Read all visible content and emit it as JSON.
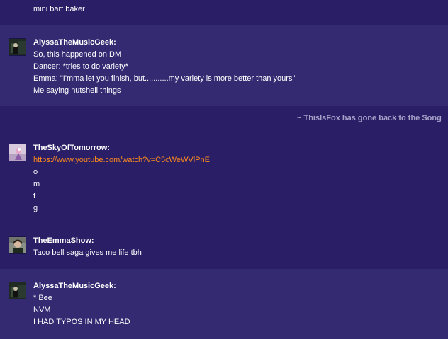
{
  "messages": [
    {
      "lines": [
        "mini bart baker"
      ]
    },
    {
      "user": "AlyssaTheMusicGeek:",
      "avatar": "avatar-alyssa",
      "lines": [
        "So, this happened on DM",
        "Dancer: *tries to do variety*",
        "Emma: \"I'mma let you finish, but...........my variety is more better than yours\"",
        "Me saying nutshell things"
      ]
    },
    {
      "status": "~ ThisIsFox has gone back to the Song"
    },
    {
      "user": "TheSkyOfTomorrow:",
      "avatar": "avatar-sky",
      "link": "https://www.youtube.com/watch?v=C5cWeWVlPnE",
      "lines": [
        "o",
        "m",
        "f",
        "g"
      ]
    },
    {
      "user": "TheEmmaShow:",
      "avatar": "avatar-emma",
      "lines": [
        "Taco bell saga gives me life tbh"
      ]
    },
    {
      "user": "AlyssaTheMusicGeek:",
      "avatar": "avatar-alyssa",
      "lines": [
        "* Bee",
        "NVM",
        "I HAD TYPOS IN MY HEAD"
      ]
    }
  ],
  "colors": {
    "background_dark": "#2a1f66",
    "background_light": "#332a72",
    "link": "#ff8a1e",
    "status_text": "#a7a2c9"
  }
}
